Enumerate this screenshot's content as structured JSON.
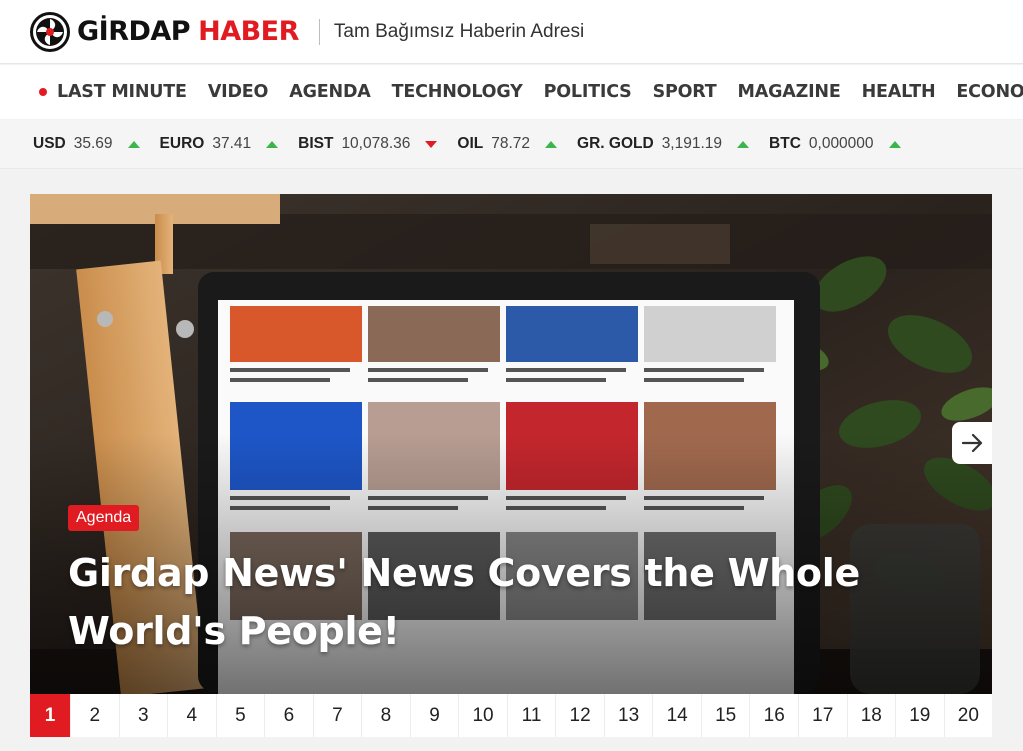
{
  "brand": {
    "name_part1": "GİRDAP",
    "name_part2": "HABER",
    "tagline": "Tam Bağımsız Haberin Adresi",
    "accent_color": "#e11b22"
  },
  "nav": {
    "items": [
      {
        "label": "LAST MINUTE",
        "live": true
      },
      {
        "label": "VIDEO"
      },
      {
        "label": "AGENDA"
      },
      {
        "label": "TECHNOLOGY"
      },
      {
        "label": "POLITICS"
      },
      {
        "label": "SPORT"
      },
      {
        "label": "MAGAZINE"
      },
      {
        "label": "HEALTH"
      },
      {
        "label": "ECONOMY"
      }
    ]
  },
  "ticker": [
    {
      "name": "USD",
      "value": "35.69",
      "trend": "up"
    },
    {
      "name": "EURO",
      "value": "37.41",
      "trend": "up"
    },
    {
      "name": "BIST",
      "value": "10,078.36",
      "trend": "down"
    },
    {
      "name": "OIL",
      "value": "78.72",
      "trend": "up"
    },
    {
      "name": "GR. GOLD",
      "value": "3,191.19",
      "trend": "up"
    },
    {
      "name": "BTC",
      "value": "0,000000",
      "trend": "up"
    }
  ],
  "hero": {
    "category": "Agenda",
    "title": "Girdap News' News Covers the Whole World's People!",
    "next_icon": "arrow-right-icon"
  },
  "pagination": {
    "active": "1",
    "pages": [
      "1",
      "2",
      "3",
      "4",
      "5",
      "6",
      "7",
      "8",
      "9",
      "10",
      "11",
      "12",
      "13",
      "14",
      "15",
      "16",
      "17",
      "18",
      "19",
      "20"
    ]
  }
}
